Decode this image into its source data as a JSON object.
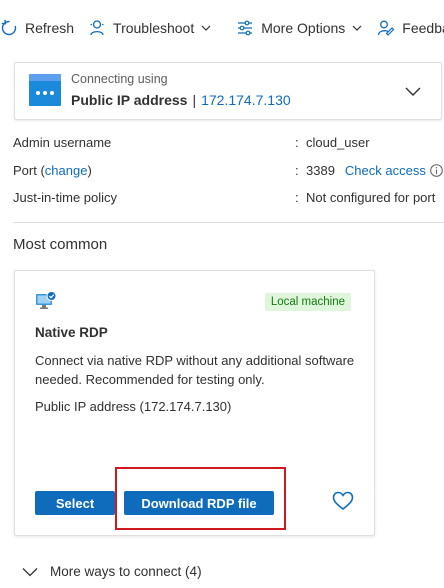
{
  "toolbar": {
    "refresh_label": "Refresh",
    "troubleshoot_label": "Troubleshoot",
    "more_options_label": "More Options",
    "feedback_label": "Feedba"
  },
  "connection": {
    "sub_label": "Connecting using",
    "type_label": "Public IP address",
    "separator": "|",
    "ip": "172.174.7.130"
  },
  "properties": {
    "admin_label": "Admin username",
    "admin_value": "cloud_user",
    "port_label": "Port",
    "port_change_link": "change",
    "port_value": "3389",
    "check_access_link": "Check access",
    "jit_label": "Just-in-time policy",
    "jit_value": "Not configured for port",
    "colon": ":"
  },
  "section_title": "Most common",
  "rdp_card": {
    "badge": "Local machine",
    "title": "Native RDP",
    "description": "Connect via native RDP without any additional software needed. Recommended for testing only.",
    "ip_line": "Public IP address (172.174.7.130)",
    "select_label": "Select",
    "download_label": "Download RDP file"
  },
  "more_ways": "More ways to connect (4)",
  "colors": {
    "accent": "#0f6cbd",
    "highlight": "#d0191f",
    "badge_bg": "#dff6dd",
    "badge_text": "#107c10"
  }
}
